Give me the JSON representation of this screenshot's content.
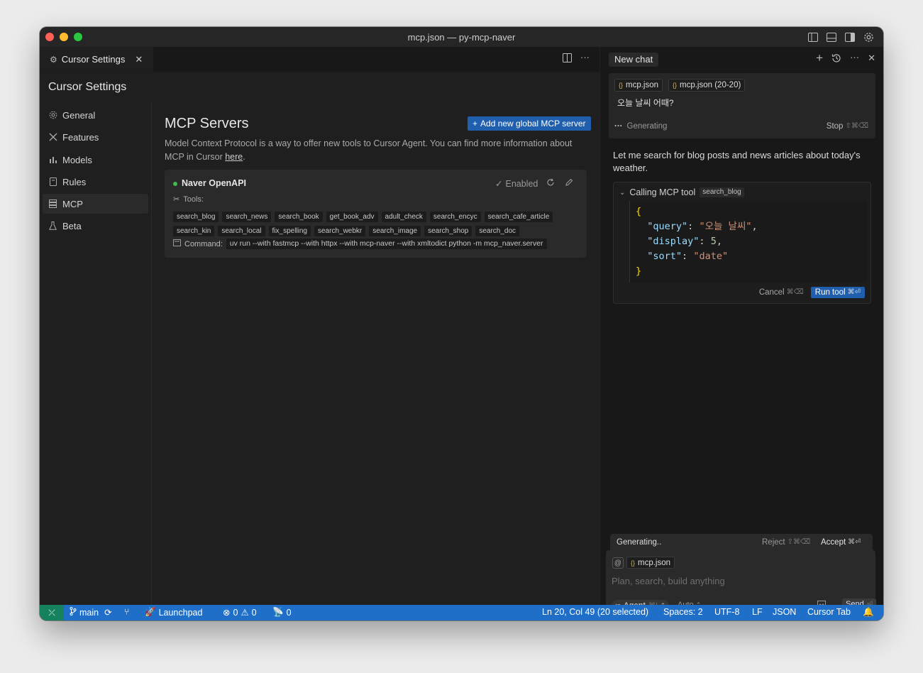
{
  "window": {
    "title": "mcp.json — py-mcp-naver"
  },
  "editor": {
    "tab_label": "Cursor Settings",
    "settings_title": "Cursor Settings",
    "nav": [
      {
        "label": "General",
        "icon": "gear-icon"
      },
      {
        "label": "Features",
        "icon": "tools-icon"
      },
      {
        "label": "Models",
        "icon": "bar-chart-icon"
      },
      {
        "label": "Rules",
        "icon": "document-icon"
      },
      {
        "label": "MCP",
        "icon": "server-icon"
      },
      {
        "label": "Beta",
        "icon": "flask-icon"
      }
    ],
    "active_nav": "MCP"
  },
  "mcp": {
    "heading": "MCP Servers",
    "add_button": "Add new global MCP server",
    "description_pre": "Model Context Protocol is a way to offer new tools to Cursor Agent. You can find more information about MCP in Cursor ",
    "description_link": "here",
    "description_post": ".",
    "server": {
      "name": "Naver OpenAPI",
      "status": "Enabled",
      "status_color": "#3fb950",
      "tools_label": "Tools:",
      "tools_row1": [
        "search_blog",
        "search_news",
        "search_book",
        "get_book_adv",
        "adult_check",
        "search_encyc",
        "search_cafe_article"
      ],
      "tools_row2": [
        "search_kin",
        "search_local",
        "fix_spelling",
        "search_webkr",
        "search_image",
        "search_shop",
        "search_doc"
      ],
      "command_label": "Command:",
      "command": "uv run --with fastmcp --with httpx --with mcp-naver --with xmltodict python -m mcp_naver.server"
    }
  },
  "chat": {
    "tab_label": "New chat",
    "context_chips": [
      "mcp.json",
      "mcp.json (20-20)"
    ],
    "user_message": "오늘 날씨 어때?",
    "generating_label": "Generating",
    "stop_label": "Stop",
    "stop_shortcut": "⇧⌘⌫",
    "assistant_message": "Let me search for blog posts and news articles about today's weather.",
    "tool_call": {
      "label": "Calling MCP tool",
      "tool_name": "search_blog",
      "args": {
        "query_key": "\"query\"",
        "query_val": "\"오늘 날씨\"",
        "display_key": "\"display\"",
        "display_val": "5",
        "sort_key": "\"sort\"",
        "sort_val": "\"date\""
      },
      "cancel_label": "Cancel",
      "cancel_shortcut": "⌘⌫",
      "run_label": "Run tool",
      "run_shortcut": "⌘⏎"
    },
    "generating_bar": {
      "label": "Generating..",
      "reject_label": "Reject",
      "reject_shortcut": "⇧⌘⌫",
      "accept_label": "Accept",
      "accept_shortcut": "⌘⏎"
    },
    "input": {
      "at_symbol": "@",
      "chip": "mcp.json",
      "placeholder": "Plan, search, build anything",
      "mode": "Agent",
      "mode_shortcut": "⌘I",
      "model": "Auto",
      "send_label": "Send",
      "send_shortcut": "⏎"
    }
  },
  "statusbar": {
    "branch": "main",
    "launchpad": "Launchpad",
    "errors": "0",
    "warnings": "0",
    "ports": "0",
    "cursor_pos": "Ln 20, Col 49 (20 selected)",
    "spaces": "Spaces: 2",
    "encoding": "UTF-8",
    "eol": "LF",
    "language": "JSON",
    "cursor_tab": "Cursor Tab"
  }
}
